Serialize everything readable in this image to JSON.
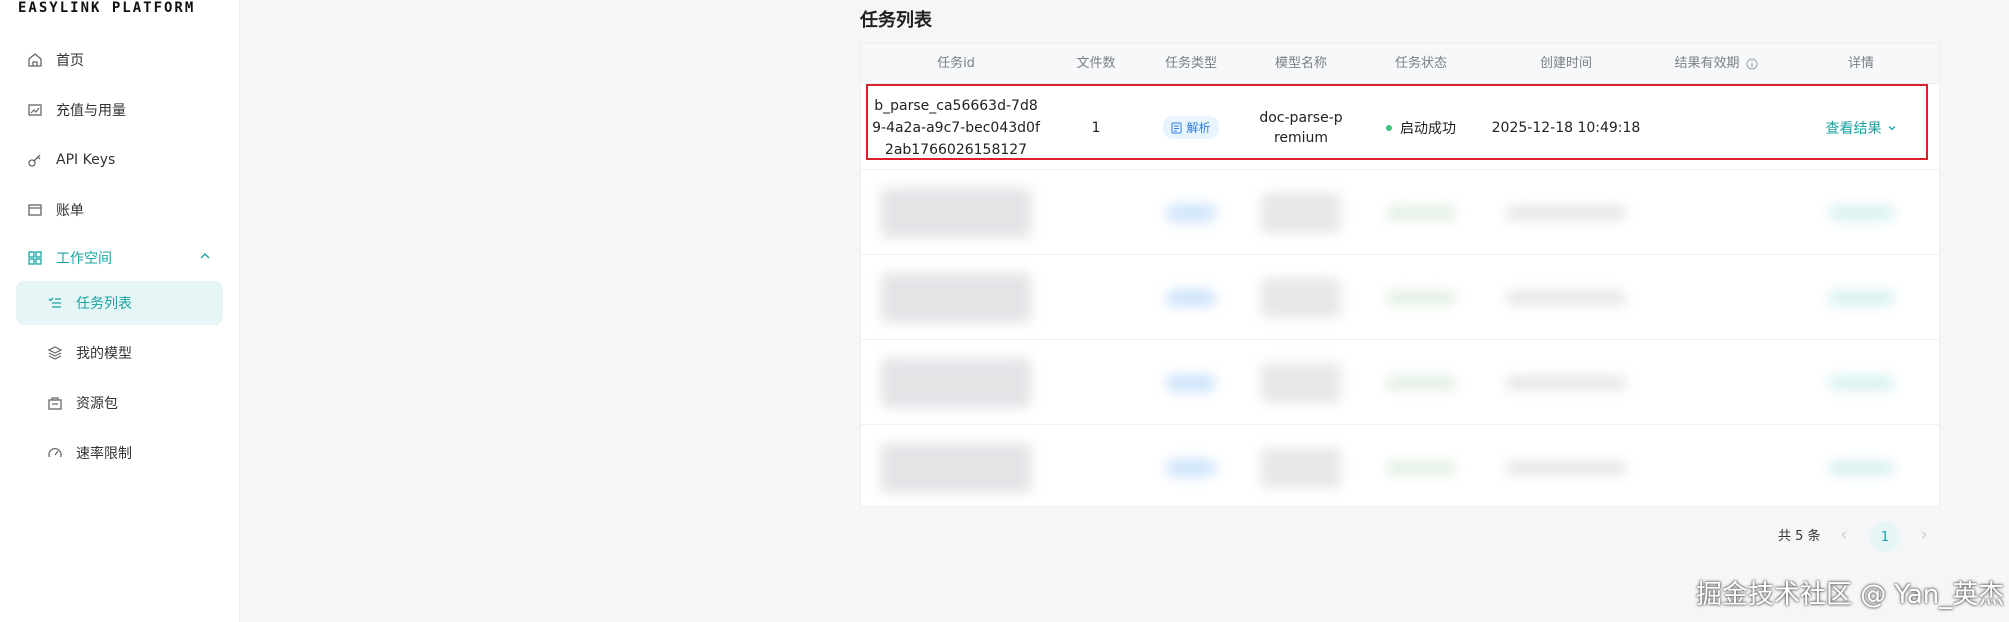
{
  "brand": "EASYLINK PLATFORM",
  "sidebar": {
    "items": [
      {
        "label": "首页",
        "icon": "home-icon"
      },
      {
        "label": "充值与用量",
        "icon": "chart-icon"
      },
      {
        "label": "API Keys",
        "icon": "key-icon"
      },
      {
        "label": "账单",
        "icon": "bill-icon"
      },
      {
        "label": "工作空间",
        "icon": "grid-icon",
        "expanded": true
      },
      {
        "label": "任务列表",
        "icon": "list-icon",
        "active": true
      },
      {
        "label": "我的模型",
        "icon": "layers-icon"
      },
      {
        "label": "资源包",
        "icon": "package-icon"
      },
      {
        "label": "速率限制",
        "icon": "gauge-icon"
      }
    ]
  },
  "main": {
    "title": "任务列表",
    "columns": [
      "任务id",
      "文件数",
      "任务类型",
      "模型名称",
      "任务状态",
      "创建时间",
      "结果有效期",
      "详情"
    ],
    "rows": [
      {
        "task_id_lines": [
          "b_parse_ca56663d-7d8",
          "9-4a2a-a9c7-bec043d0f",
          "2ab1766026158127"
        ],
        "file_count": "1",
        "task_type": "解析",
        "model_lines": [
          "doc-parse-p",
          "remium"
        ],
        "status": "启动成功",
        "created": "2025-12-18 10:49:18",
        "expiry": "",
        "action": "查看结果"
      }
    ],
    "blurred_row_count": 4
  },
  "pagination": {
    "total_label": "共 5 条",
    "current_page": "1"
  },
  "watermark": "掘金技术社区 @ Yan_英杰",
  "colors": {
    "accent": "#1aa3a3",
    "highlight_border": "#d9212c",
    "status_dot": "#3bc47a",
    "tag_bg": "#e8f4ff",
    "tag_text": "#2f7fd8"
  }
}
